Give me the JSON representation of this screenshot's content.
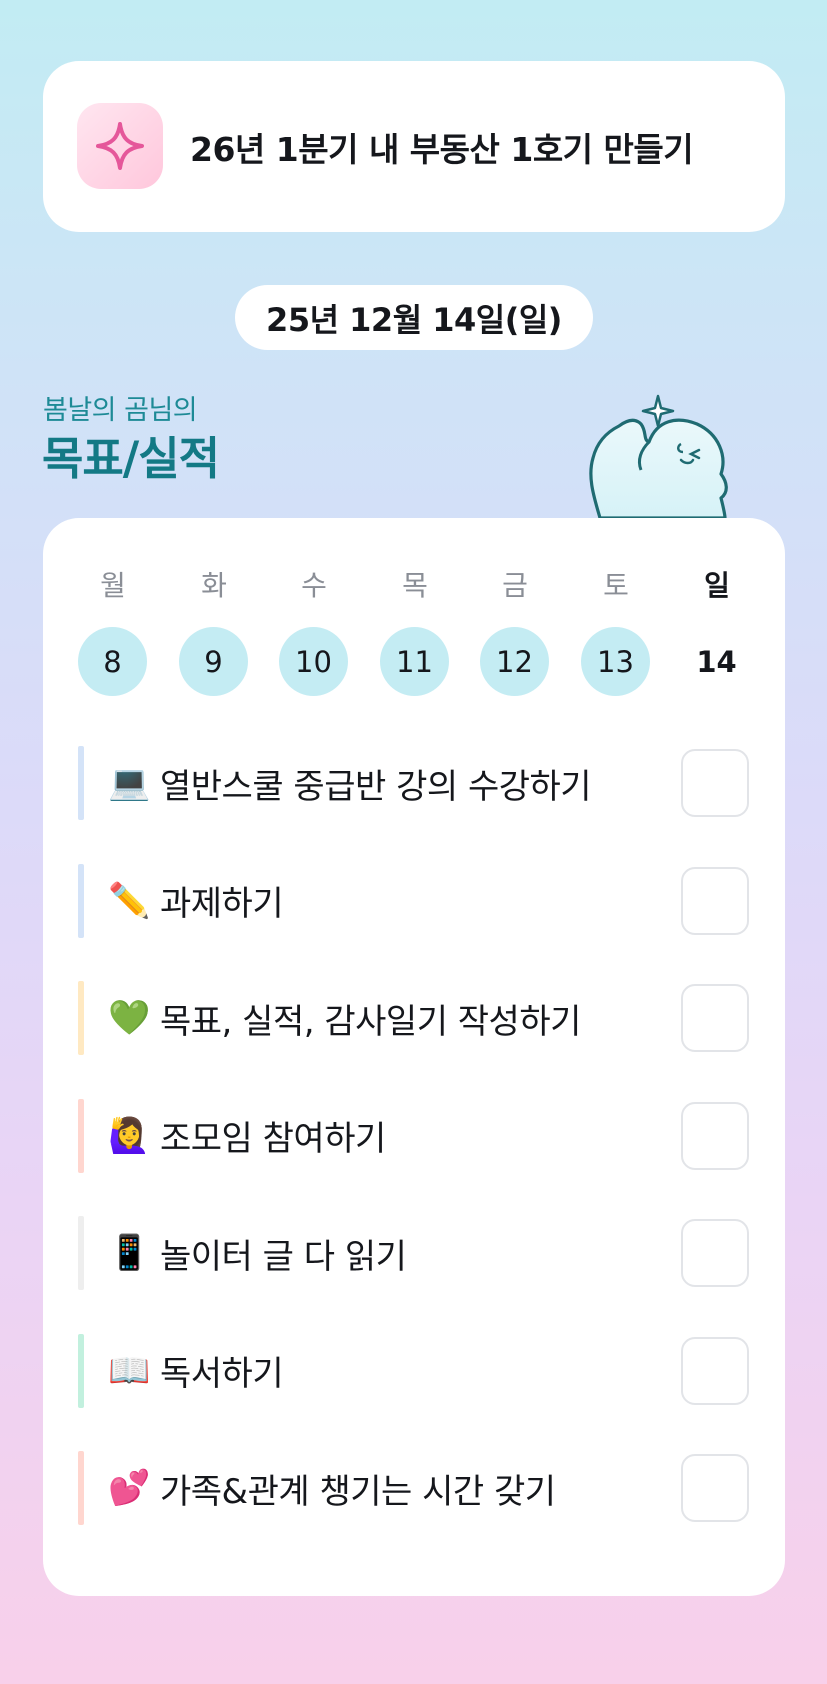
{
  "goal": {
    "icon": "sparkle-icon",
    "text": "26년 1분기 내 부동산 1호기 만들기"
  },
  "date": "25년 12월 14일(일)",
  "header": {
    "subtitle": "봄날의 곰님의",
    "title": "목표/실적"
  },
  "week": [
    {
      "label": "월",
      "num": "8",
      "today": false
    },
    {
      "label": "화",
      "num": "9",
      "today": false
    },
    {
      "label": "수",
      "num": "10",
      "today": false
    },
    {
      "label": "목",
      "num": "11",
      "today": false
    },
    {
      "label": "금",
      "num": "12",
      "today": false
    },
    {
      "label": "토",
      "num": "13",
      "today": false
    },
    {
      "label": "일",
      "num": "14",
      "today": true
    }
  ],
  "tasks": [
    {
      "emoji": "💻",
      "label": "열반스쿨 중급반 강의 수강하기",
      "bar_color": "#d4e3f8",
      "checked": false
    },
    {
      "emoji": "✏️",
      "label": "과제하기",
      "bar_color": "#d4e3f8",
      "checked": false
    },
    {
      "emoji": "💚",
      "label": "목표, 실적, 감사일기 작성하기",
      "bar_color": "#ffe9c2",
      "checked": false
    },
    {
      "emoji": "🙋‍♀️",
      "label": "조모임 참여하기",
      "bar_color": "#ffd6cf",
      "checked": false
    },
    {
      "emoji": "📱",
      "label": "놀이터 글 다 읽기",
      "bar_color": "#eeeeee",
      "checked": false
    },
    {
      "emoji": "📖",
      "label": "독서하기",
      "bar_color": "#c2f0de",
      "checked": false
    },
    {
      "emoji": "💕",
      "label": "가족&관계 챙기는 시간 갖기",
      "bar_color": "#ffd6cf",
      "checked": false
    }
  ],
  "colors": {
    "accent": "#137985",
    "day_circle": "#c4ecf3"
  }
}
